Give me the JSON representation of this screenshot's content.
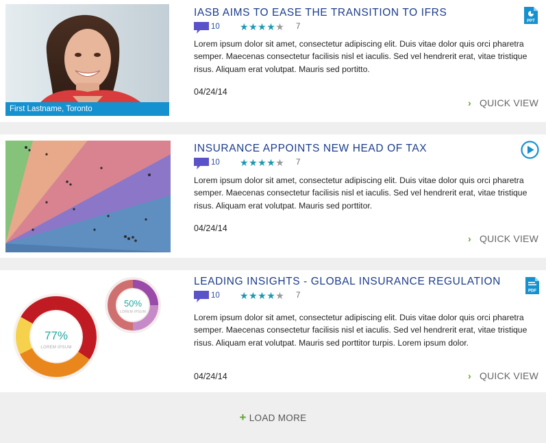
{
  "articles": [
    {
      "title": "IASB AIMS TO EASE THE TRANSITION TO IFRS",
      "comments": "10",
      "stars_filled": 4,
      "stars_total": 5,
      "rating": "7",
      "body": "Lorem ipsum dolor sit amet, consectetur adipiscing elit. Duis vitae dolor quis orci pharetra semper. Maecenas consectetur facilisis nisl et iaculis. Sed vel hendrerit erat, vitae tristique risus. Aliquam erat volutpat. Mauris sed portitto.",
      "date": "04/24/14",
      "quick_view": "QUICK VIEW",
      "type_icon": "ppt-icon",
      "type_label": "PPT",
      "thumb_caption": "First Lastname, Toronto"
    },
    {
      "title": "INSURANCE APPOINTS NEW HEAD OF TAX",
      "comments": "10",
      "stars_filled": 4,
      "stars_total": 5,
      "rating": "7",
      "body": "Lorem ipsum dolor sit amet, consectetur adipiscing elit. Duis vitae dolor quis orci pharetra semper. Maecenas consectetur facilisis nisl et iaculis. Sed vel hendrerit erat, vitae tristique risus. Aliquam erat volutpat. Mauris sed porttitor.",
      "date": "04/24/14",
      "quick_view": "QUICK VIEW",
      "type_icon": "video-play-icon"
    },
    {
      "title": "LEADING INSIGHTS - GLOBAL INSURANCE REGULATION",
      "comments": "10",
      "stars_filled": 4,
      "stars_total": 5,
      "rating": "7",
      "body": "Lorem ipsum dolor sit amet, consectetur adipiscing elit. Duis vitae dolor quis orci pharetra semper. Maecenas consectetur facilisis nisl et iaculis. Sed vel hendrerit erat, vitae tristique risus. Aliquam erat volutpat. Mauris sed porttitor turpis. Lorem ipsum dolor.",
      "date": "04/24/14",
      "quick_view": "QUICK VIEW",
      "type_icon": "pdf-icon",
      "type_label": "PDF",
      "thumb_donuts": [
        {
          "value": "77%",
          "label": "LOREM IPSUM"
        },
        {
          "value": "50%",
          "label": "LOREM IPSUM"
        }
      ]
    }
  ],
  "load_more": "LOAD MORE",
  "colors": {
    "title": "#1a3c8c",
    "star": "#1d97b3",
    "accent_green": "#5ea62b",
    "caption_bar": "#1591cf",
    "icon_blue": "#1591cf",
    "comment_bubble": "#5a52c8"
  }
}
